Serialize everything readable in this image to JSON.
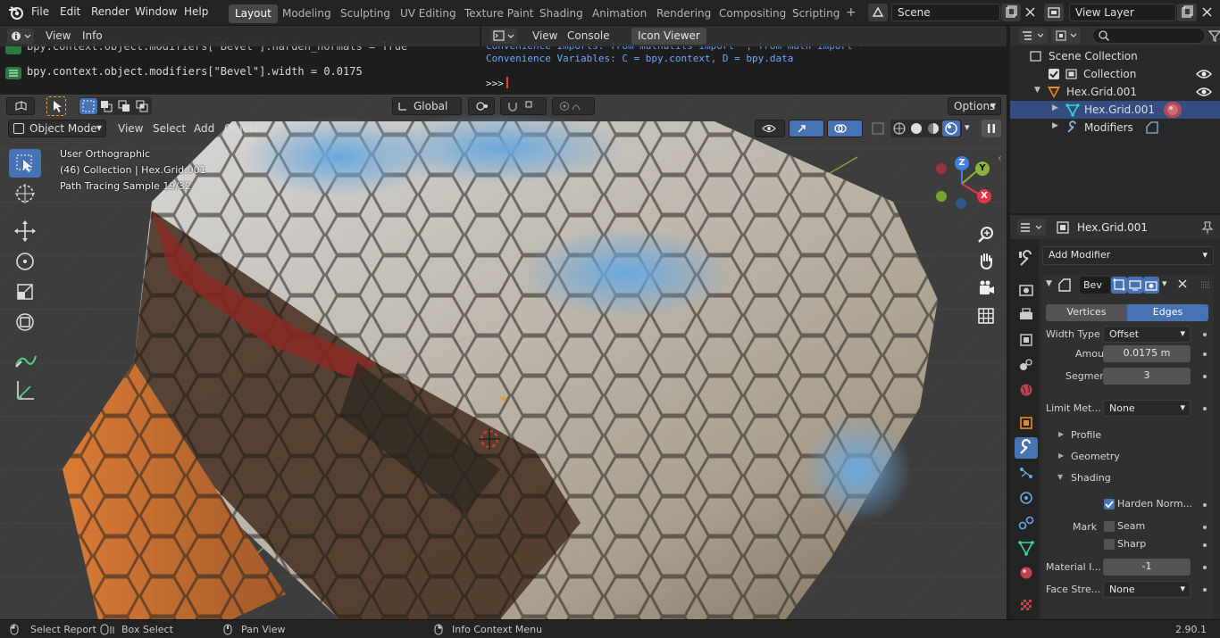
{
  "topbar": {
    "menus": [
      "File",
      "Edit",
      "Render",
      "Window",
      "Help"
    ],
    "workspaces": [
      "Layout",
      "Modeling",
      "Sculpting",
      "UV Editing",
      "Texture Paint",
      "Shading",
      "Animation",
      "Rendering",
      "Compositing",
      "Scripting"
    ],
    "active_workspace": "Layout",
    "add_tab": "+",
    "scene": "Scene",
    "view_layer": "View Layer"
  },
  "info": {
    "menus": [
      "View",
      "Info"
    ],
    "lines": [
      "bpy.context.object.modifiers[\"Bevel\"].harden_normals = True",
      "bpy.context.object.modifiers[\"Bevel\"].width = 0.0175"
    ]
  },
  "console": {
    "menus": [
      "View",
      "Console"
    ],
    "icon_viewer": "Icon Viewer",
    "lines": [
      "Convenience Imports:   from mathutils import *; from math import *",
      "Convenience Variables: C = bpy.context, D = bpy.data"
    ],
    "prompt": ">>>"
  },
  "viewport": {
    "mode": "Object Mode",
    "menus": [
      "View",
      "Select",
      "Add",
      "Object"
    ],
    "orientation": "Global",
    "options": "Options",
    "overlay": {
      "view_name": "User Orthographic",
      "collection": "(46) Collection | Hex.Grid.001",
      "sample": "Path Tracing Sample 19/32"
    },
    "gizmo": {
      "x": "X",
      "y": "Y",
      "z": "Z"
    }
  },
  "outliner": {
    "search_placeholder": "",
    "rows": [
      "Scene Collection",
      "Collection",
      "Hex.Grid.001",
      "Hex.Grid.001",
      "Modifiers"
    ]
  },
  "properties": {
    "object_name": "Hex.Grid.001",
    "add_modifier": "Add Modifier",
    "modifier_name": "Bev",
    "affect": [
      "Vertices",
      "Edges"
    ],
    "active_affect": "Edges",
    "fields": {
      "width_type_label": "Width Type",
      "width_type": "Offset",
      "amount_label": "Amount",
      "amount": "0.0175 m",
      "segments_label": "Segments",
      "segments": "3",
      "limit_label": "Limit Met...",
      "limit": "None"
    },
    "sections": [
      "Profile",
      "Geometry",
      "Shading"
    ],
    "shading": {
      "harden": "Harden Norm...",
      "harden_checked": true,
      "mark_label": "Mark",
      "seam": "Seam",
      "seam_checked": false,
      "sharp": "Sharp",
      "sharp_checked": false,
      "material_label": "Material I...",
      "material": "-1",
      "face_label": "Face Stre...",
      "face": "None"
    }
  },
  "status": {
    "items": [
      "Select Report",
      "Box Select",
      "Pan View",
      "Info Context Menu"
    ],
    "version": "2.90.1"
  },
  "colors": {
    "accent": "#4772b3",
    "selected_row": "#334d80",
    "console_text": "#6ea8ff",
    "gizmo_x": "#e0364b",
    "gizmo_y": "#8ab33b",
    "gizmo_z": "#3f7fe5"
  }
}
